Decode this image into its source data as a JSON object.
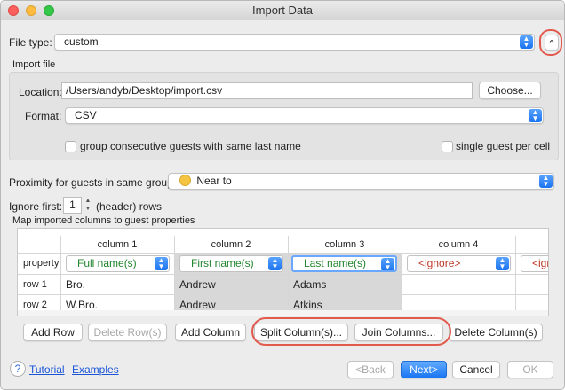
{
  "window": {
    "title": "Import Data"
  },
  "file_type": {
    "label": "File type:",
    "value": "custom",
    "collapse_glyph": "⌃"
  },
  "import_file": {
    "section_label": "Import file",
    "location_label": "Location:",
    "location_value": "/Users/andyb/Desktop/import.csv",
    "choose_label": "Choose...",
    "format_label": "Format:",
    "format_value": "CSV",
    "group_consecutive_label": "group consecutive guests with same last name",
    "single_guest_label": "single guest per cell"
  },
  "proximity": {
    "label": "Proximity for guests in same group:",
    "value": "Near to",
    "icon": "smiley-icon"
  },
  "ignore": {
    "label": "Ignore first:",
    "value": "1",
    "suffix": "(header) rows"
  },
  "map": {
    "label": "Map imported columns to guest properties",
    "columns": [
      "column 1",
      "column 2",
      "column 3",
      "column 4"
    ],
    "property_label": "property",
    "properties": [
      "Full name(s)",
      "First name(s)",
      "Last name(s)",
      "<ignore>",
      "<ign"
    ],
    "rows": [
      {
        "label": "row 1",
        "cells": [
          "Bro.",
          "Andrew",
          "Adams",
          ""
        ]
      },
      {
        "label": "row 2",
        "cells": [
          "W.Bro.",
          "Andrew",
          "Atkins",
          ""
        ]
      }
    ]
  },
  "buttons": {
    "add_row": "Add Row",
    "delete_rows": "Delete Row(s)",
    "add_column": "Add Column",
    "split_columns": "Split Column(s)...",
    "join_columns": "Join Columns...",
    "delete_columns": "Delete Column(s)"
  },
  "footer": {
    "help_glyph": "?",
    "tutorial": "Tutorial",
    "examples": "Examples",
    "back": "<Back",
    "next": "Next>",
    "cancel": "Cancel",
    "ok": "OK"
  },
  "colors": {
    "accent": "#1a76f2",
    "highlight": "#e25a4d",
    "property_text": "#22852e",
    "ignore_text": "#c0392b"
  }
}
